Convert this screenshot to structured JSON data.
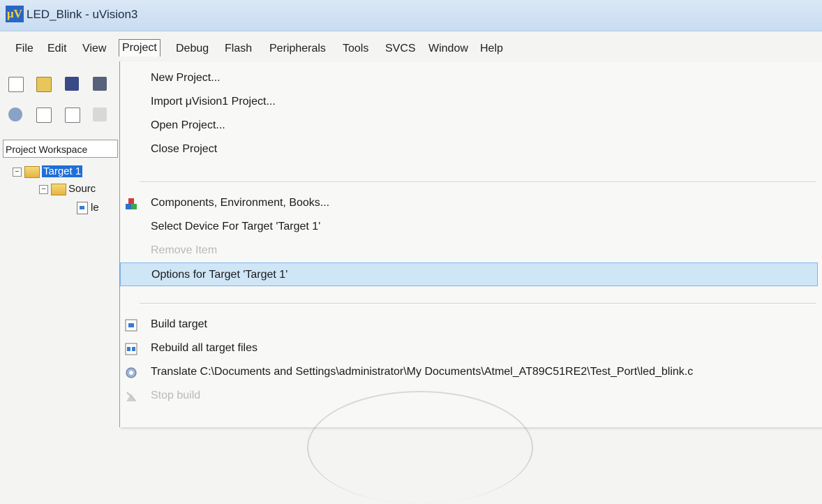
{
  "window": {
    "title": "LED_Blink - uVision3",
    "app_icon_text": "μV"
  },
  "menubar": [
    "File",
    "Edit",
    "View",
    "Project",
    "Debug",
    "Flash",
    "Peripherals",
    "Tools",
    "SVCS",
    "Window",
    "Help"
  ],
  "workspace": {
    "tab_label": "Project Workspace",
    "tree": {
      "target": "Target 1",
      "group": "Sourc",
      "file": "le"
    }
  },
  "project_menu": {
    "items": {
      "new_project": "New Project...",
      "import_project": "Import μVision1 Project...",
      "open_project": "Open Project...",
      "close_project": "Close Project",
      "components": "Components, Environment, Books...",
      "select_device": "Select Device For Target 'Target 1'",
      "remove_item": "Remove Item",
      "options_target": "Options for Target 'Target 1'",
      "build_target": "Build target",
      "rebuild_all": "Rebuild all target files",
      "translate": "Translate C:\\Documents and Settings\\administrator\\My Documents\\Atmel_AT89C51RE2\\Test_Port\\led_blink.c",
      "stop_build": "Stop build"
    }
  },
  "colors": {
    "highlight": "#cfe6f7",
    "selection": "#1f6fd8",
    "disabled": "#b9b9b9"
  }
}
